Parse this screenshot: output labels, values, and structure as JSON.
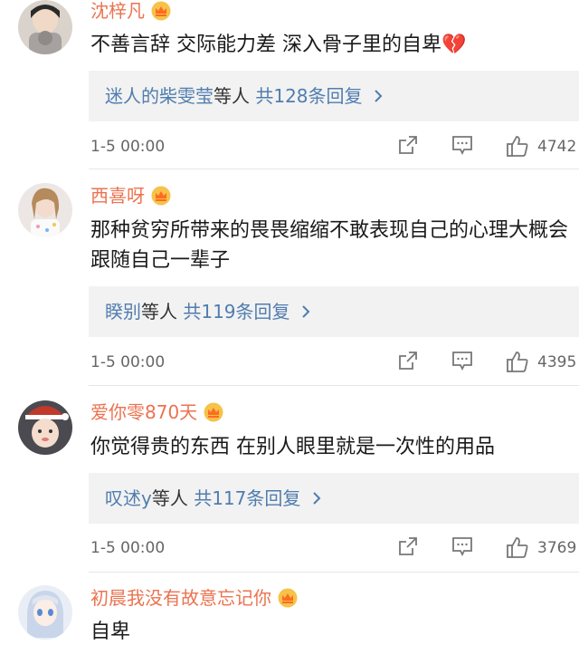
{
  "comments": [
    {
      "username": "沈梓凡",
      "text": "不善言辞 交际能力差 深入骨子里的自卑",
      "text_emoji": "💔",
      "replies": {
        "name": "迷人的柴雯莹",
        "mid": "等人 ",
        "count": "共128条回复"
      },
      "date": "1-5 00:00",
      "likes": "4742"
    },
    {
      "username": "西喜呀",
      "text": "那种贫穷所带来的畏畏缩缩不敢表现自己的心理大概会跟随自己一辈子",
      "replies": {
        "name": "睽别",
        "mid": "等人 ",
        "count": "共119条回复"
      },
      "date": "1-5 00:00",
      "likes": "4395"
    },
    {
      "username": "爱你零870天",
      "text": "你觉得贵的东西 在别人眼里就是一次性的用品",
      "replies": {
        "name": "叹述y",
        "mid": "等人 ",
        "count": "共117条回复"
      },
      "date": "1-5 00:00",
      "likes": "3769"
    },
    {
      "username": "初晨我没有故意忘记你",
      "text": "自卑"
    }
  ],
  "colors": {
    "username": "#eb7350",
    "link": "#507daf",
    "reply_bg": "#f2f2f2",
    "meta": "#666666"
  },
  "icons": [
    "crown-vip-icon",
    "share-icon",
    "comment-icon",
    "like-icon",
    "chevron-right-icon",
    "broken-heart-icon"
  ]
}
